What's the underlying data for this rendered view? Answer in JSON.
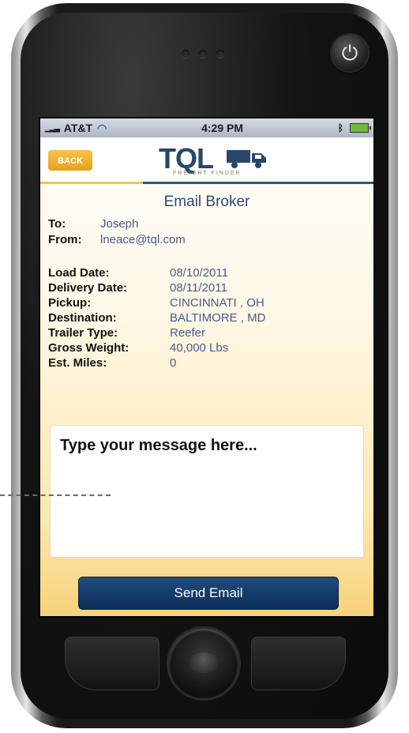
{
  "status_bar": {
    "carrier": "AT&T",
    "time": "4:29 PM",
    "icons": [
      "signal-icon",
      "wifi-icon",
      "bluetooth-icon",
      "battery-icon"
    ]
  },
  "header": {
    "back_label": "BACK",
    "logo_text": "TQL",
    "logo_tagline": "FREIGHT FINDER"
  },
  "page": {
    "title": "Email Broker"
  },
  "addressing": {
    "to_label": "To:",
    "to_value": "Joseph",
    "from_label": "From:",
    "from_value": "lneace@tql.com"
  },
  "details": [
    {
      "label": "Load Date:",
      "value": "08/10/2011"
    },
    {
      "label": "Delivery Date:",
      "value": "08/11/2011"
    },
    {
      "label": "Pickup:",
      "value": "CINCINNATI , OH"
    },
    {
      "label": "Destination:",
      "value": "BALTIMORE , MD"
    },
    {
      "label": "Trailer Type:",
      "value": "Reefer"
    },
    {
      "label": "Gross Weight:",
      "value": "40,000 Lbs"
    },
    {
      "label": "Est. Miles:",
      "value": "0"
    }
  ],
  "message": {
    "placeholder": "Type your message here..."
  },
  "actions": {
    "send_label": "Send Email"
  },
  "colors": {
    "brand_navy": "#27476b",
    "accent_gold": "#f7c24a",
    "button_blue": "#1f4c7e"
  }
}
